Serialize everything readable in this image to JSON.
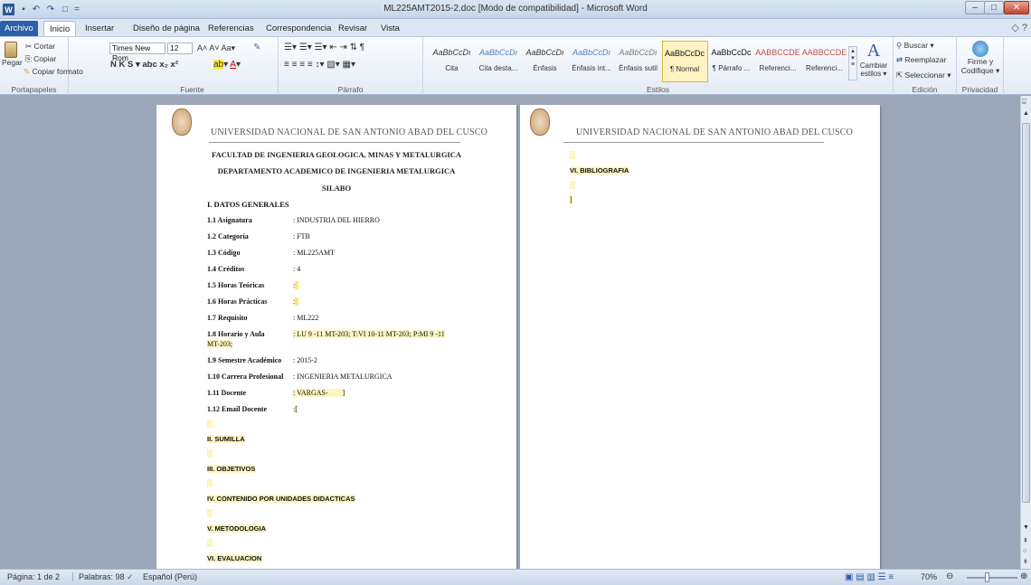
{
  "window": {
    "title": "ML225AMT2015-2.doc [Modo de compatibilidad] - Microsoft Word",
    "minimize": "–",
    "maximize": "□",
    "close": "✕"
  },
  "qat": {
    "logo": "W",
    "save": "▪",
    "undo": "↶",
    "redo": "↷",
    "new": "□",
    "more": "="
  },
  "tabs": [
    "Archivo",
    "Inicio",
    "Insertar",
    "Diseño de página",
    "Referencias",
    "Correspondencia",
    "Revisar",
    "Vista"
  ],
  "help": "◇ ?",
  "ribbon": {
    "clipboard": {
      "label": "Portapapeles",
      "paste": "Pegar",
      "cut": "Cortar",
      "copy": "Copiar",
      "format": "Copiar formato"
    },
    "font": {
      "label": "Fuente",
      "name": "Times New Rom",
      "size": "12",
      "row1": "A˄ A˅  Aa▾",
      "row2": "N  K  S ▾ abc x₂ x²"
    },
    "paragraph": {
      "label": "Párrafo",
      "row1": "☰▾ ☰▾ ☰▾  ⇤ ⇥  ⇅  ¶",
      "row2": "≡  ≡  ≡  ≡   ↕▾  ▧▾ ▦▾"
    },
    "styles": {
      "label": "Estilos",
      "items": [
        {
          "preview": "AaBbCcDı",
          "name": "Cita",
          "color": "#333333"
        },
        {
          "preview": "AaBbCcDı",
          "name": "Cita desta...",
          "color": "#4f81bd"
        },
        {
          "preview": "AaBbCcDı",
          "name": "Énfasis",
          "color": "#333333"
        },
        {
          "preview": "AaBbCcDı",
          "name": "Énfasis int...",
          "color": "#4f81bd"
        },
        {
          "preview": "AaBbCcDı",
          "name": "Énfasis sutil",
          "color": "#777777"
        },
        {
          "preview": "AaBbCcDc",
          "name": "¶ Normal",
          "color": "#111111"
        },
        {
          "preview": "AaBbCcDc",
          "name": "¶ Párrafo ...",
          "color": "#111111"
        },
        {
          "preview": "AABBCCDE",
          "name": "Referenci...",
          "color": "#c0504d"
        },
        {
          "preview": "AABBCCDE",
          "name": "Referenci...",
          "color": "#c0504d"
        }
      ],
      "change": "Cambiar estilos ▾"
    },
    "editing": {
      "label": "Edición",
      "find": "Buscar ▾",
      "replace": "Reemplazar",
      "select": "Seleccionar ▾"
    },
    "privacy": {
      "label": "Privacidad",
      "sign": "Firme y",
      "sign2": "Codifique ▾"
    }
  },
  "page1": {
    "university": "UNIVERSIDAD NACIONAL DE SAN ANTONIO ABAD DEL CUSCO",
    "faculty": "FACULTAD DE INGENIERIA GEOLOGICA, MINAS Y METALURGICA",
    "department": "DEPARTAMENTO  ACADEMICO DE INGENIERIA METALURGICA",
    "doc": "SILABO",
    "general": "I. DATOS GENERALES",
    "rows": [
      {
        "label": "1.1  Asignatura",
        "value": ": INDUSTRIA DEL HIERRO"
      },
      {
        "label": "1.2  Categoría",
        "value": ": FTB"
      },
      {
        "label": "1.3  Código",
        "value": ": ML225AMT"
      },
      {
        "label": "1.4  Créditos",
        "value": ": 4"
      },
      {
        "label": "1.5  Horas Teóricas",
        "value": ":"
      },
      {
        "label": "1.6  Horas Prácticas",
        "value": ":"
      },
      {
        "label": "1.7  Requisito",
        "value": ": ML222"
      },
      {
        "label": "1.8  Horario y Aula",
        "value": ": LU 9 -11 MT-203;  T:VI 10-11 MT-203;  P:MI 9 -11"
      },
      {
        "label": "MT-203;",
        "value": ""
      },
      {
        "label": "1.9  Semestre Académico",
        "value": ": 2015-2"
      },
      {
        "label": "1.10 Carrera Profesional",
        "value": ": INGENIERIA METALURGICA"
      },
      {
        "label": "1.11 Docente",
        "value": ": VARGAS-"
      },
      {
        "label": "1.12 Email Docente",
        "value": ":"
      }
    ],
    "sections": [
      "II. SUMILLA",
      "III. OBJETIVOS",
      "IV. CONTENIDO  POR UNIDADES DIDACTICAS",
      "V. METODOLOGIA",
      "VI. EVALUACION"
    ]
  },
  "page2": {
    "university": "UNIVERSIDAD NACIONAL DE SAN ANTONIO ABAD DEL CUSCO",
    "section": "VI. BIBLIOGRAFIA",
    "bracket": "]"
  },
  "status": {
    "page": "Página: 1 de 2",
    "words": "Palabras: 98",
    "language": "Español (Perú)",
    "zoom": "70%",
    "zoom_fraction": 0.7
  }
}
